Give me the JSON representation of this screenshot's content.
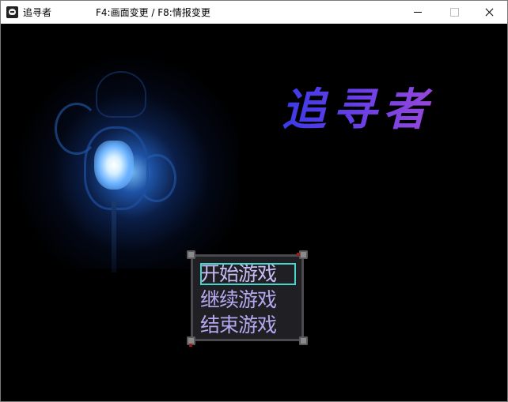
{
  "window": {
    "title": "追寻者",
    "hint": "F4:画面变更 / F8:情报变更"
  },
  "logo": {
    "text": "追寻者",
    "gradient_start": "#3a3ae8",
    "gradient_end": "#a44ad8"
  },
  "menu": {
    "items": [
      {
        "label": "开始游戏",
        "selected": true
      },
      {
        "label": "继续游戏",
        "selected": false
      },
      {
        "label": "结束游戏",
        "selected": false
      }
    ],
    "text_color": "#b6a8f0",
    "selection_color": "#48d6cc"
  }
}
